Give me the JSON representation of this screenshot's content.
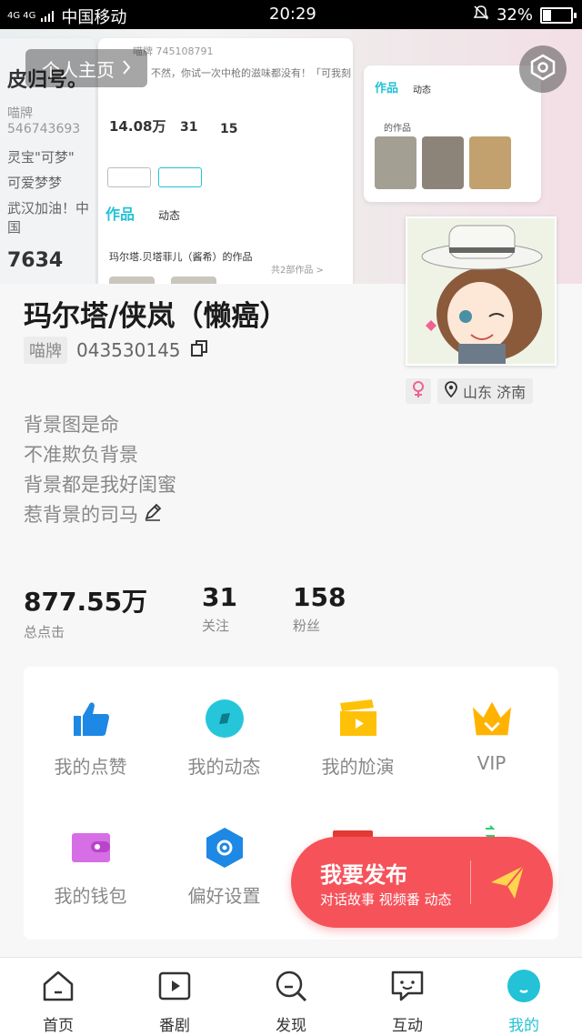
{
  "status_bar": {
    "network": "4G 4G",
    "carrier": "中国移动",
    "time": "20:29",
    "battery": "32%"
  },
  "banner": {
    "personal_page_label": "个人主页",
    "bg_card": {
      "id_text": "喵牌 745108791",
      "stats": [
        "14.08万",
        "31",
        "15"
      ],
      "tab_works": "作品",
      "tab_dynamic": "动态",
      "works_title": "玛尔塔.贝塔菲儿（酱希）的作品",
      "works_count": "共2部作品 >",
      "left_snippets": [
        "皮归号。",
        "喵牌 546743693",
        "灵宝\"可梦\"",
        "可爱梦梦",
        "武汉加油！中国",
        "7634"
      ],
      "quote": "不然，你试一次中枪的滋味都没有！「可我刻"
    },
    "bg_card2": {
      "tab_works": "作品",
      "tab_dynamic": "动态",
      "section": "的作品"
    }
  },
  "profile": {
    "name": "玛尔塔/侠岚（懒癌）",
    "id_tag": "喵牌",
    "id_number": "043530145",
    "location": "山东 济南",
    "bio": [
      "背景图是命",
      "不准欺负背景",
      "背景都是我好闺蜜",
      "惹背景的司马"
    ]
  },
  "stats": [
    {
      "value": "877.55万",
      "label": "总点击"
    },
    {
      "value": "31",
      "label": "关注"
    },
    {
      "value": "158",
      "label": "粉丝"
    }
  ],
  "grid": [
    {
      "label": "我的点赞",
      "icon": "thumbs-up-icon",
      "color": "#1e88e5"
    },
    {
      "label": "我的动态",
      "icon": "compass-icon",
      "color": "#26c6da"
    },
    {
      "label": "我的尬演",
      "icon": "clapperboard-icon",
      "color": "#ffc107"
    },
    {
      "label": "VIP",
      "icon": "crown-icon",
      "color": "#ffb300"
    },
    {
      "label": "我的钱包",
      "icon": "wallet-icon",
      "color": "#d66ee6"
    },
    {
      "label": "偏好设置",
      "icon": "hexagon-settings-icon",
      "color": "#1e88e5"
    }
  ],
  "publish": {
    "title": "我要发布",
    "subtitle": "对话故事 视频番 动态"
  },
  "nav": [
    {
      "label": "首页",
      "icon": "home-icon"
    },
    {
      "label": "番剧",
      "icon": "play-icon"
    },
    {
      "label": "发现",
      "icon": "search-icon"
    },
    {
      "label": "互动",
      "icon": "message-icon"
    },
    {
      "label": "我的",
      "icon": "profile-icon"
    }
  ],
  "colors": {
    "accent": "#23c2d6",
    "publish": "#f6525a",
    "gender": "#f06292"
  }
}
